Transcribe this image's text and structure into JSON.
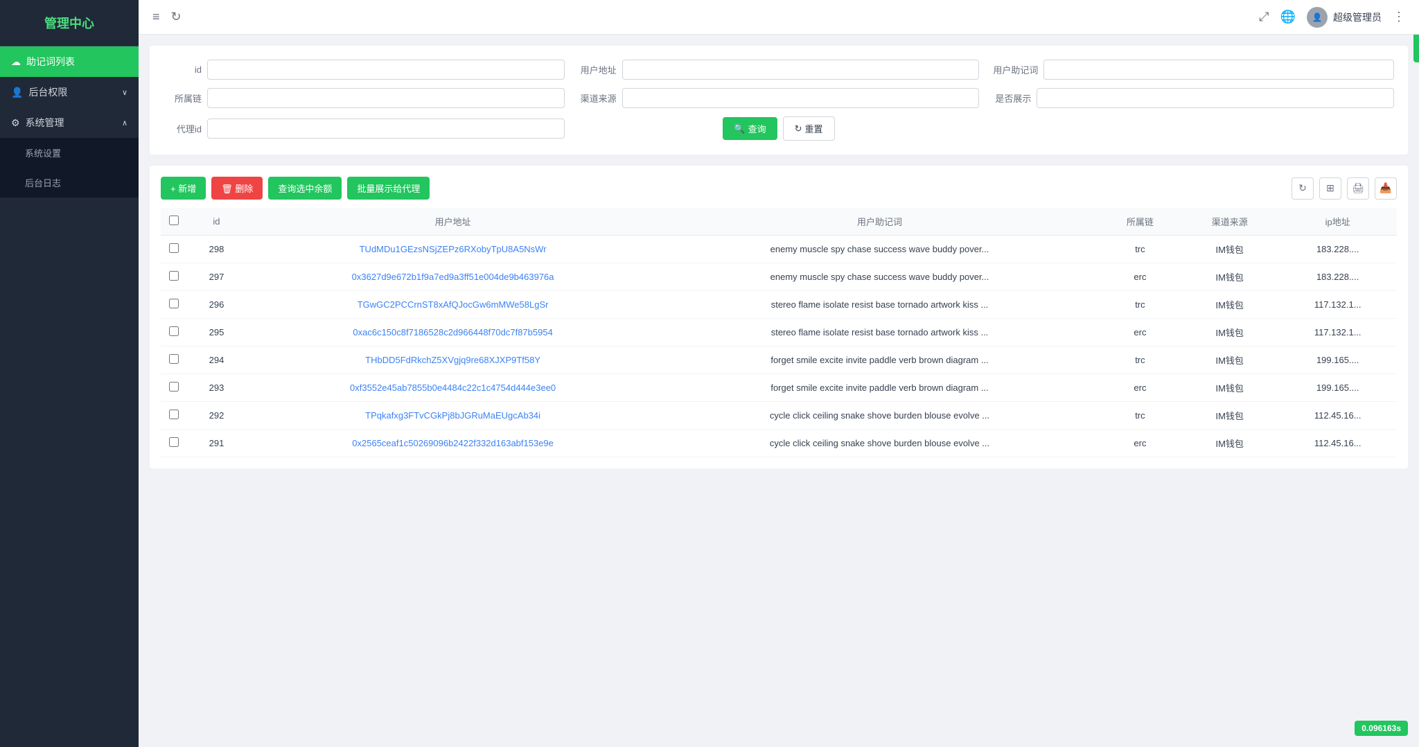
{
  "sidebar": {
    "title": "管理中心",
    "items": [
      {
        "id": "mnemonic-list",
        "label": "助记词列表",
        "icon": "☁",
        "active": true,
        "hasArrow": false
      },
      {
        "id": "backend-permissions",
        "label": "后台权限",
        "icon": "👤",
        "active": false,
        "hasArrow": true
      },
      {
        "id": "system-management",
        "label": "系统管理",
        "icon": "⚙",
        "active": false,
        "hasArrow": true,
        "expanded": true
      },
      {
        "id": "system-settings",
        "label": "系统设置",
        "icon": "",
        "active": false,
        "sub": true
      },
      {
        "id": "backend-log",
        "label": "后台日志",
        "icon": "",
        "active": false,
        "sub": true
      }
    ]
  },
  "header": {
    "menu_icon": "≡",
    "refresh_icon": "↻",
    "fullscreen_icon": "⤢",
    "globe_icon": "🌐",
    "more_icon": "⋮",
    "username": "超级管理员"
  },
  "filter": {
    "labels": {
      "id": "id",
      "user_address": "用户地址",
      "user_mnemonic": "用户助记词",
      "chain": "所属链",
      "channel_source": "渠道来源",
      "is_display": "是否展示",
      "agent_id": "代理id"
    },
    "buttons": {
      "search": "查询",
      "reset": "重置"
    }
  },
  "toolbar": {
    "add_label": "+ 新增",
    "delete_label": "🗑 删除",
    "query_balance_label": "查询选中余额",
    "batch_display_label": "批量展示给代理",
    "refresh_icon": "↻",
    "grid_icon": "⊞",
    "print_icon": "🖨",
    "export_icon": "📥"
  },
  "table": {
    "columns": [
      "id",
      "用户地址",
      "用户助记词",
      "所属链",
      "渠道来源",
      "ip地址"
    ],
    "rows": [
      {
        "id": "298",
        "address": "TUdMDu1GEzsNSjZEPz6RXobyTpU8A5NsWr",
        "mnemonic": "enemy muscle spy chase success wave buddy pover...",
        "chain": "trc",
        "channel": "IM钱包",
        "ip": "183.228...."
      },
      {
        "id": "297",
        "address": "0x3627d9e672b1f9a7ed9a3ff51e004de9b463976a",
        "mnemonic": "enemy muscle spy chase success wave buddy pover...",
        "chain": "erc",
        "channel": "IM钱包",
        "ip": "183.228...."
      },
      {
        "id": "296",
        "address": "TGwGC2PCCrnST8xAfQJocGw6mMWe58LgSr",
        "mnemonic": "stereo flame isolate resist base tornado artwork kiss ...",
        "chain": "trc",
        "channel": "IM钱包",
        "ip": "117.132.1..."
      },
      {
        "id": "295",
        "address": "0xac6c150c8f7186528c2d966448f70dc7f87b5954",
        "mnemonic": "stereo flame isolate resist base tornado artwork kiss ...",
        "chain": "erc",
        "channel": "IM钱包",
        "ip": "117.132.1..."
      },
      {
        "id": "294",
        "address": "THbDD5FdRkchZ5XVgjq9re68XJXP9Tf58Y",
        "mnemonic": "forget smile excite invite paddle verb brown diagram ...",
        "chain": "trc",
        "channel": "IM钱包",
        "ip": "199.165...."
      },
      {
        "id": "293",
        "address": "0xf3552e45ab7855b0e4484c22c1c4754d444e3ee0",
        "mnemonic": "forget smile excite invite paddle verb brown diagram ...",
        "chain": "erc",
        "channel": "IM钱包",
        "ip": "199.165...."
      },
      {
        "id": "292",
        "address": "TPqkafxg3FTvCGkPj8bJGRuMaEUgcAb34i",
        "mnemonic": "cycle click ceiling snake shove burden blouse evolve ...",
        "chain": "trc",
        "channel": "IM钱包",
        "ip": "112.45.16..."
      },
      {
        "id": "291",
        "address": "0x2565ceaf1c50269096b2422f332d163abf153e9e",
        "mnemonic": "cycle click ceiling snake shove burden blouse evolve ...",
        "chain": "erc",
        "channel": "IM钱包",
        "ip": "112.45.16..."
      }
    ]
  },
  "bottom_badge": "0.096163s",
  "colors": {
    "primary": "#22c55e",
    "danger": "#ef4444",
    "link": "#3b82f6",
    "sidebar_bg": "#1f2937"
  }
}
